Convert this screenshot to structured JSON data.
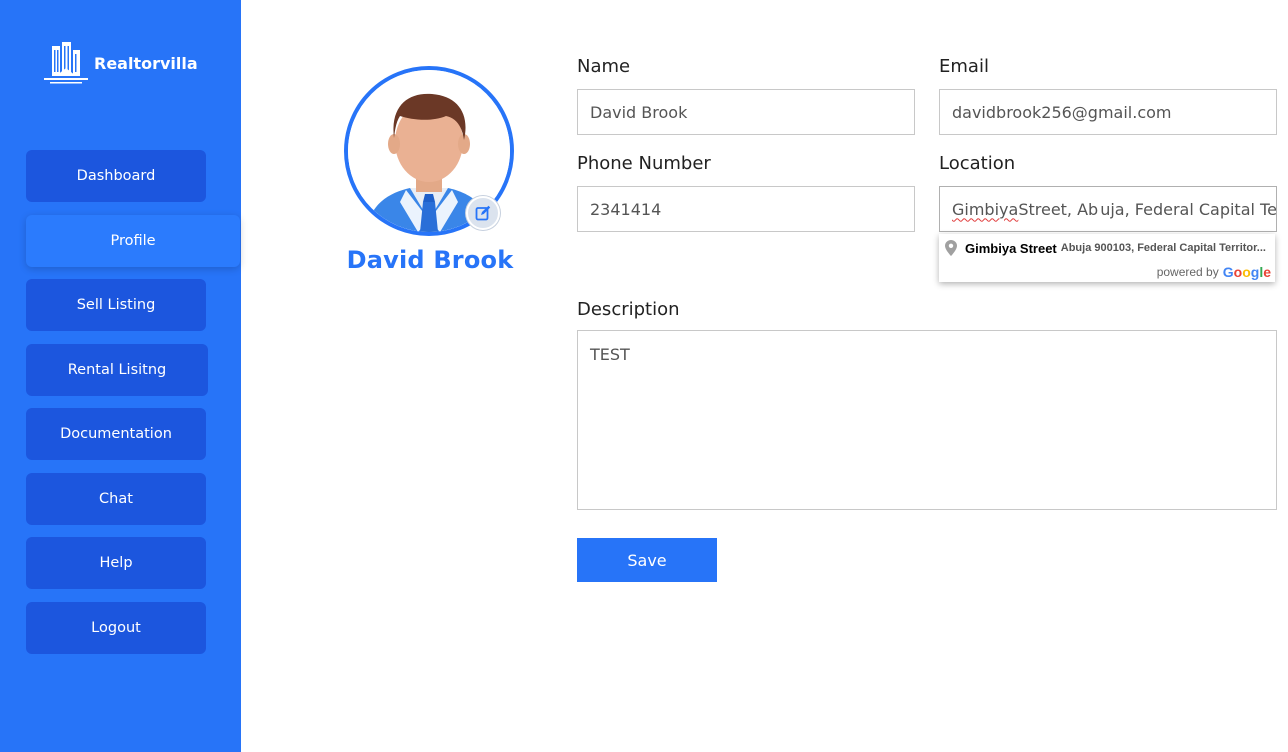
{
  "brand": {
    "name": "Realtorvilla",
    "accent": "#2774f8",
    "nav_color": "#1c56de"
  },
  "sidebar": {
    "items": [
      {
        "label": "Dashboard",
        "active": false
      },
      {
        "label": "Profile",
        "active": true
      },
      {
        "label": "Sell Listing",
        "active": false
      },
      {
        "label": "Rental Lisitng",
        "active": false
      },
      {
        "label": "Documentation",
        "active": false
      },
      {
        "label": "Chat",
        "active": false
      },
      {
        "label": "Help",
        "active": false
      },
      {
        "label": "Logout",
        "active": false
      }
    ]
  },
  "profile": {
    "name": "David Brook",
    "avatar_icon": "user-avatar-icon",
    "edit_icon": "edit-icon"
  },
  "form": {
    "name_label": "Name",
    "name_value": "David Brook",
    "email_label": "Email",
    "email_value": "davidbrook256@gmail.com",
    "phone_label": "Phone Number",
    "phone_value": "2341414",
    "location_label": "Location",
    "location_value_part1": "Gimbiya",
    "location_value_part2": " Street, Ab",
    "location_value_part3": "uja, Federal Capital Te",
    "description_label": "Description",
    "description_value": "TEST",
    "save_label": "Save"
  },
  "autocomplete": {
    "main_text": "Gimbiya Street",
    "secondary_text": "Abuja 900103, Federal Capital Territor...",
    "powered_by": "powered by",
    "google": "Google",
    "pin_icon": "map-pin-icon"
  }
}
